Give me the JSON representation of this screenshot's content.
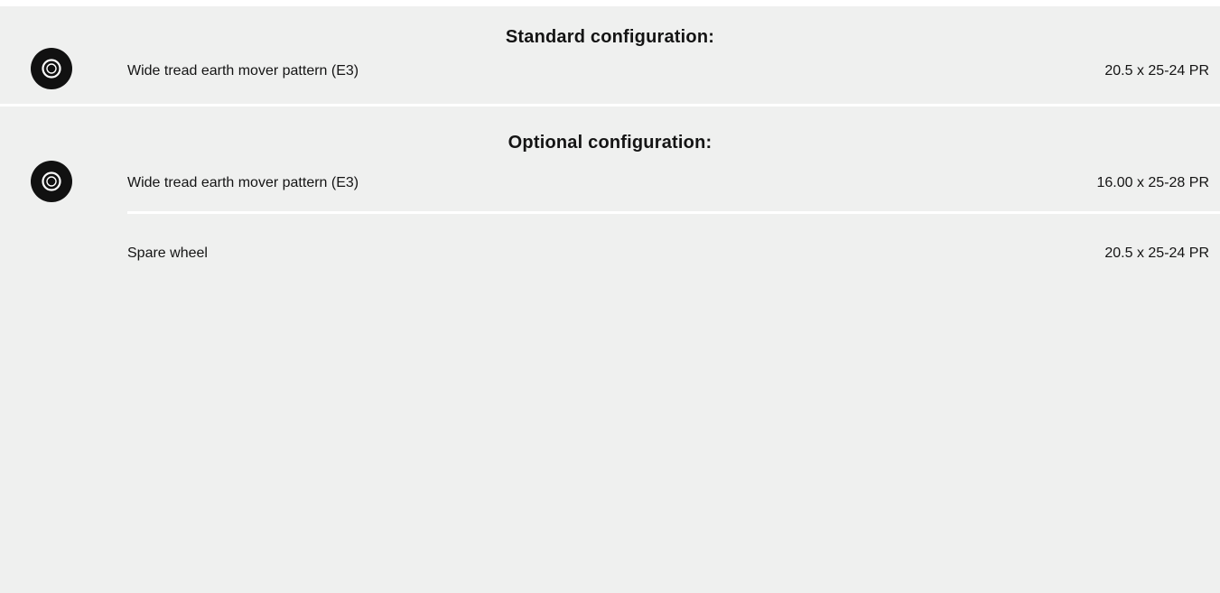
{
  "standard": {
    "title": "Standard configuration:",
    "icon": "tire-icon",
    "rows": [
      {
        "label": "Wide tread earth mover pattern (E3)",
        "value": "20.5 x 25-24 PR"
      }
    ]
  },
  "optional": {
    "title": "Optional configuration:",
    "icon": "tire-icon",
    "rows": [
      {
        "label": "Wide tread earth mover pattern (E3)",
        "value": "16.00 x 25-28 PR"
      },
      {
        "label": "Spare wheel",
        "value": "20.5 x 25-24 PR"
      }
    ]
  },
  "colors": {
    "panel_background": "#eff0ef",
    "divider": "#ffffff",
    "text": "#141414",
    "icon": "#111111"
  }
}
